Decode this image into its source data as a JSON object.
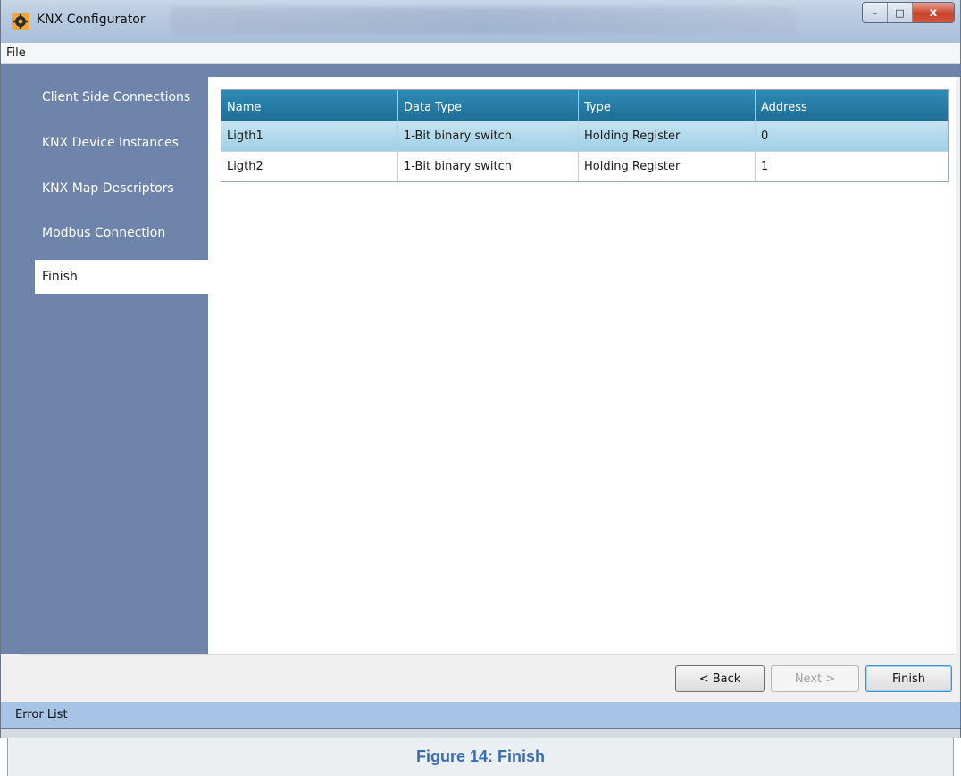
{
  "window": {
    "title": "KNX Configurator",
    "icon": "gear-icon",
    "controls": {
      "minimize": "–",
      "maximize": "□",
      "close": "x"
    }
  },
  "menu": {
    "file": "File"
  },
  "sidebar": {
    "items": [
      {
        "label": "Client Side Connections",
        "active": false
      },
      {
        "label": "KNX Device Instances",
        "active": false
      },
      {
        "label": "KNX Map Descriptors",
        "active": false
      },
      {
        "label": "Modbus Connection",
        "active": false
      },
      {
        "label": "Finish",
        "active": true
      }
    ]
  },
  "grid": {
    "columns": [
      "Name",
      "Data Type",
      "Type",
      "Address"
    ],
    "rows": [
      {
        "name": "Ligth1",
        "data_type": "1-Bit binary switch",
        "type": "Holding Register",
        "address": "0",
        "selected": true
      },
      {
        "name": "Ligth2",
        "data_type": "1-Bit binary switch",
        "type": "Holding Register",
        "address": "1",
        "selected": false
      }
    ]
  },
  "buttons": {
    "back": "< Back",
    "next": "Next >",
    "finish": "Finish"
  },
  "status": {
    "error_list": "Error List"
  },
  "caption": "Figure 14: Finish",
  "colors": {
    "sidebar": "#6f84ab",
    "grid_header": "#2474a0",
    "selected_row": "#b3daee",
    "error_bar": "#a7c4e6",
    "caption_text": "#3a6db0"
  }
}
